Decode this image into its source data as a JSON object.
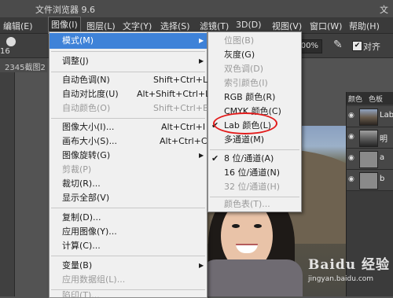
{
  "window": {
    "title": "文件浏览器 9.6",
    "title_right": "文"
  },
  "menubar": [
    {
      "label": "编辑(E)"
    },
    {
      "label": "图像(I)"
    },
    {
      "label": "图层(L)"
    },
    {
      "label": "文字(Y)"
    },
    {
      "label": "选择(S)"
    },
    {
      "label": "滤镜(T)"
    },
    {
      "label": "3D(D)"
    },
    {
      "label": "视图(V)"
    },
    {
      "label": "窗口(W)"
    },
    {
      "label": "帮助(H)"
    }
  ],
  "options": {
    "brush_size": "16",
    "zoom": "00%",
    "align_label": "对齐"
  },
  "doc_tab": "2345截图2",
  "layers_panel": {
    "tabs": [
      "颜色",
      "色板"
    ],
    "layers": [
      {
        "name": "Lab"
      },
      {
        "name": "明"
      },
      {
        "name": "a"
      },
      {
        "name": "b"
      }
    ]
  },
  "image_menu": {
    "items": [
      {
        "label": "模式(M)",
        "shortcut": "",
        "submenu": true,
        "disabled": false,
        "highlighted": true
      },
      {
        "label": "调整(J)",
        "shortcut": "",
        "submenu": true,
        "disabled": false
      },
      {
        "label": "自动色调(N)",
        "shortcut": "Shift+Ctrl+L",
        "disabled": false
      },
      {
        "label": "自动对比度(U)",
        "shortcut": "Alt+Shift+Ctrl+L",
        "disabled": false
      },
      {
        "label": "自动颜色(O)",
        "shortcut": "Shift+Ctrl+B",
        "disabled": true
      },
      {
        "label": "图像大小(I)...",
        "shortcut": "Alt+Ctrl+I",
        "disabled": false
      },
      {
        "label": "画布大小(S)...",
        "shortcut": "Alt+Ctrl+C",
        "disabled": false
      },
      {
        "label": "图像旋转(G)",
        "shortcut": "",
        "submenu": true,
        "disabled": false
      },
      {
        "label": "剪裁(P)",
        "shortcut": "",
        "disabled": true
      },
      {
        "label": "裁切(R)...",
        "shortcut": "",
        "disabled": false
      },
      {
        "label": "显示全部(V)",
        "shortcut": "",
        "disabled": false
      },
      {
        "label": "复制(D)...",
        "shortcut": "",
        "disabled": false
      },
      {
        "label": "应用图像(Y)...",
        "shortcut": "",
        "disabled": false
      },
      {
        "label": "计算(C)...",
        "shortcut": "",
        "disabled": false
      },
      {
        "label": "变量(B)",
        "shortcut": "",
        "submenu": true,
        "disabled": false
      },
      {
        "label": "应用数据组(L)...",
        "shortcut": "",
        "disabled": true
      },
      {
        "label": "陷印(T)...",
        "shortcut": "",
        "disabled": true
      }
    ]
  },
  "mode_submenu": {
    "items": [
      {
        "label": "位图(B)",
        "disabled": true,
        "checked": false
      },
      {
        "label": "灰度(G)",
        "disabled": false,
        "checked": false
      },
      {
        "label": "双色调(D)",
        "disabled": true,
        "checked": false
      },
      {
        "label": "索引颜色(I)",
        "disabled": true,
        "checked": false
      },
      {
        "label": "RGB 颜色(R)",
        "disabled": false,
        "checked": false
      },
      {
        "label": "CMYK 颜色(C)",
        "disabled": false,
        "checked": false
      },
      {
        "label": "Lab 颜色(L)",
        "disabled": false,
        "checked": true,
        "circled": true
      },
      {
        "label": "多通道(M)",
        "disabled": false,
        "checked": false
      },
      {
        "label": "8 位/通道(A)",
        "disabled": false,
        "checked": true
      },
      {
        "label": "16 位/通道(N)",
        "disabled": false,
        "checked": false
      },
      {
        "label": "32 位/通道(H)",
        "disabled": true,
        "checked": false
      },
      {
        "label": "颜色表(T)...",
        "disabled": true,
        "checked": false
      }
    ]
  },
  "watermark": {
    "logo": "Baidu 经验",
    "url": "jingyan.baidu.com"
  },
  "colors": {
    "highlight": "#3e82d8",
    "menu_bg": "#f0f0f0",
    "circle": "#e21a1a",
    "disabled_text": "#9a9a9a"
  }
}
